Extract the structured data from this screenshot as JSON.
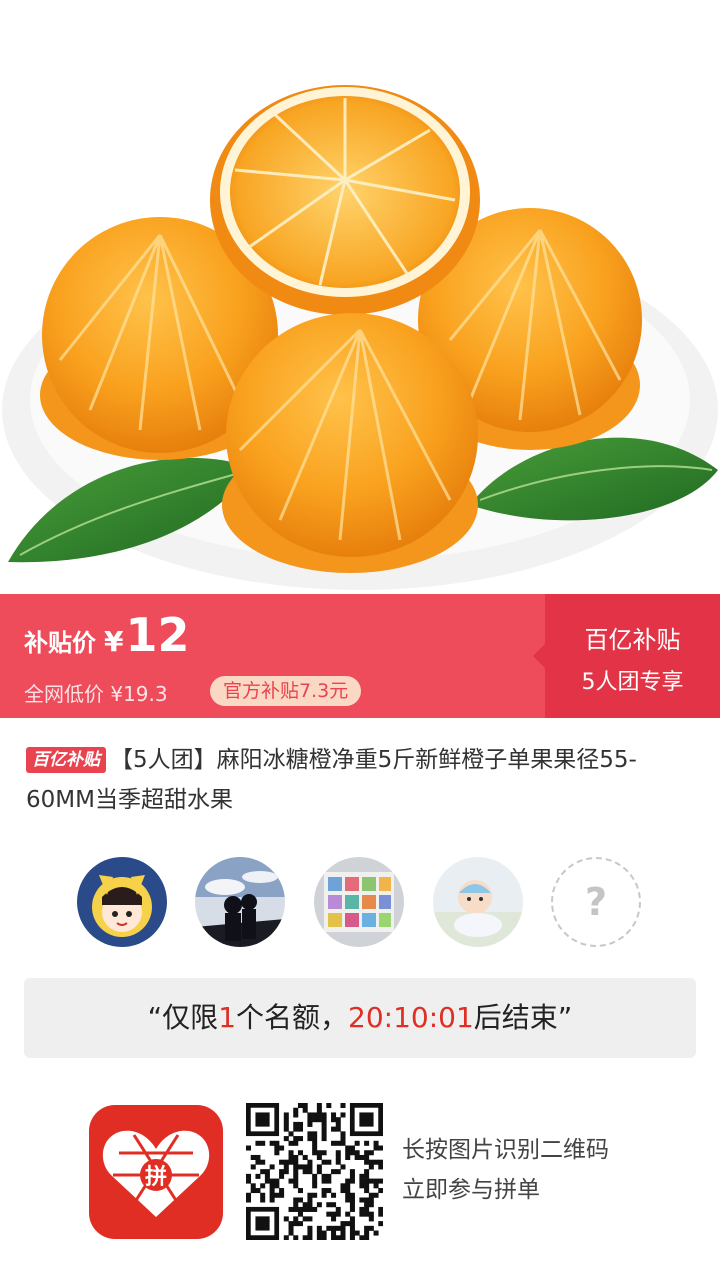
{
  "hero": {
    "image_alt": "peeled-oranges-on-plate"
  },
  "price": {
    "label": "补贴价",
    "currency": "¥",
    "value": "12",
    "market_price": "全网低价 ¥19.3",
    "subsidy_tag": "官方补贴7.3元",
    "promo_line1": "百亿补贴",
    "promo_line2": "5人团专享"
  },
  "product": {
    "badge": "百亿补贴",
    "title": "【5人团】麻阳冰糖橙净重5斤新鲜橙子单果果径55-60MM当季超甜水果"
  },
  "group": {
    "members": [
      "avatar-cartoon",
      "avatar-silhouette",
      "avatar-wall",
      "avatar-baby"
    ],
    "empty_slot": "?"
  },
  "notice": {
    "prefix": "“仅限",
    "count": "1",
    "middle": "个名额，",
    "countdown": "20:10:01",
    "suffix": "后结束”"
  },
  "footer": {
    "logo_text": "拼",
    "line1": "长按图片识别二维码",
    "line2": "立即参与拼单"
  },
  "colors": {
    "accent": "#ee4b5b",
    "accent_dark": "#e23446",
    "brand_red": "#e02e24"
  }
}
